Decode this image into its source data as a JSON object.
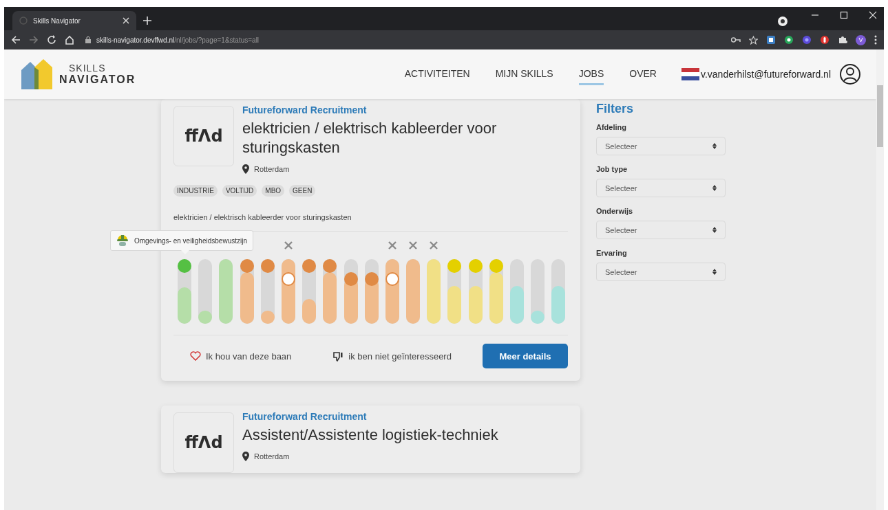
{
  "browser": {
    "tab_title": "Skills Navigator",
    "url_host": "skills-navigator.devffwd.nl",
    "url_path": "/nl/jobs/?page=1&status=all",
    "profile_initial": "V"
  },
  "header": {
    "logo_top": "SKILLS",
    "logo_bottom": "NAVIGATOR",
    "nav": [
      {
        "label": "ACTIVITEITEN",
        "selected": false
      },
      {
        "label": "MIJN SKILLS",
        "selected": false
      },
      {
        "label": "JOBS",
        "selected": true
      },
      {
        "label": "OVER",
        "selected": false
      }
    ],
    "user_email": "v.vanderhilst@futureforward.nl"
  },
  "jobs": [
    {
      "logo": "ffɅd",
      "company": "Futureforward Recruitment",
      "title": "elektricien / elektrisch kableerder voor sturingskasten",
      "location": "Rotterdam",
      "tags": [
        "INDUSTRIE",
        "VOLTIJD",
        "MBO",
        "GEEN"
      ],
      "description": "elektricien / elektrisch kableerder voor sturingskasten",
      "tooltip": "Omgevings- en veiligheidsbewustzijn",
      "skills": [
        {
          "color": "#b5dea8",
          "level": 0.56,
          "dot": {
            "kind": "filled",
            "color": "#55c043",
            "level": 1
          }
        },
        {
          "color": "#b5dea8",
          "level": 0.2
        },
        {
          "color": "#b5dea8",
          "level": 1
        },
        {
          "color": "#f0bb8c",
          "level": 0.8,
          "dot": {
            "kind": "filled",
            "color": "#e08a45",
            "level": 1
          }
        },
        {
          "color": "#f0bb8c",
          "level": 0.2,
          "dot": {
            "kind": "filled",
            "color": "#e08a45",
            "level": 1
          }
        },
        {
          "color": "#f0bb8c",
          "level": 1,
          "crossed": true,
          "dot": {
            "kind": "hollow",
            "color": "#e08a45",
            "level": 0.75
          }
        },
        {
          "color": "#f0bb8c",
          "level": 0.38,
          "dot": {
            "kind": "filled",
            "color": "#e08a45",
            "level": 1
          }
        },
        {
          "color": "#f0bb8c",
          "level": 0.8,
          "dot": {
            "kind": "filled",
            "color": "#e08a45",
            "level": 1
          }
        },
        {
          "color": "#f0bb8c",
          "level": 0.7,
          "dot": {
            "kind": "filled",
            "color": "#e08a45",
            "level": 0.75
          }
        },
        {
          "color": "#f0bb8c",
          "level": 0.7,
          "dot": {
            "kind": "filled",
            "color": "#e08a45",
            "level": 0.75
          }
        },
        {
          "color": "#f0bb8c",
          "level": 1,
          "crossed": true,
          "dot": {
            "kind": "hollow",
            "color": "#e08a45",
            "level": 0.75
          }
        },
        {
          "color": "#f0bb8c",
          "level": 1,
          "crossed": true
        },
        {
          "color": "#f1e086",
          "level": 1,
          "crossed": true
        },
        {
          "color": "#f1e086",
          "level": 0.58,
          "dot": {
            "kind": "filled",
            "color": "#e4d000",
            "level": 1
          }
        },
        {
          "color": "#f1e086",
          "level": 0.58,
          "dot": {
            "kind": "filled",
            "color": "#e4d000",
            "level": 1
          }
        },
        {
          "color": "#f1e086",
          "level": 0.8,
          "dot": {
            "kind": "filled",
            "color": "#e4d000",
            "level": 1
          }
        },
        {
          "color": "#a8e2dc",
          "level": 0.58
        },
        {
          "color": "#a8e2dc",
          "level": 0.2
        },
        {
          "color": "#a8e2dc",
          "level": 0.58
        }
      ],
      "like": "Ik hou van deze baan",
      "dislike": "ik ben niet geïnteresseerd",
      "details": "Meer details"
    },
    {
      "logo": "ffɅd",
      "company": "Futureforward Recruitment",
      "title": "Assistent/Assistente logistiek-techniek",
      "location": "Rotterdam"
    }
  ],
  "filters": {
    "title": "Filters",
    "groups": [
      {
        "label": "Afdeling",
        "value": "Selecteer"
      },
      {
        "label": "Job type",
        "value": "Selecteer"
      },
      {
        "label": "Onderwijs",
        "value": "Selecteer"
      },
      {
        "label": "Ervaring",
        "value": "Selecteer"
      }
    ]
  }
}
